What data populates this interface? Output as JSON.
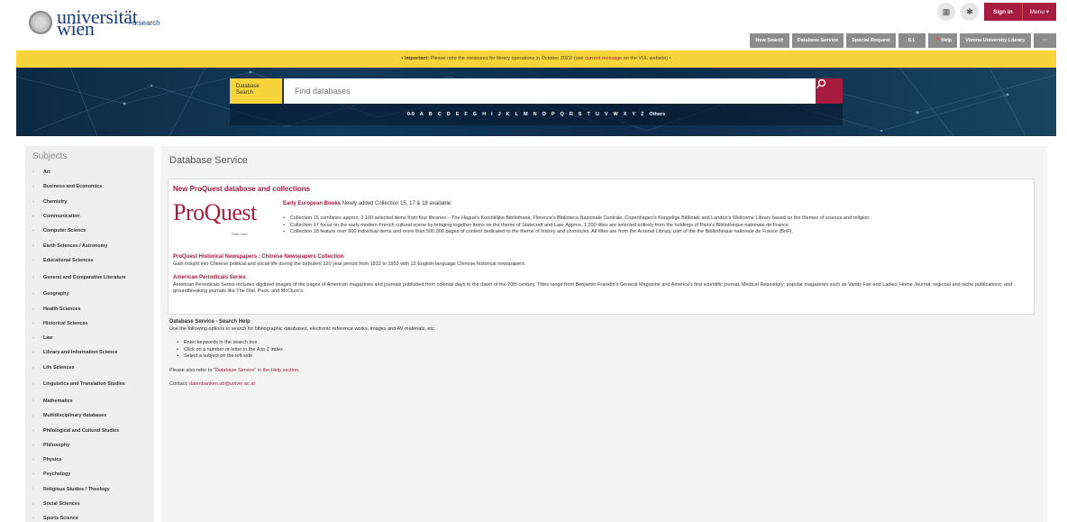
{
  "header": {
    "logo_line1": "universität",
    "logo_line2": "wien",
    "breadcrumb": "› u:search",
    "signin_label": "Sign in",
    "menu_label": "Menu ▾"
  },
  "nav": {
    "items": [
      "New Search",
      "Database Service",
      "Special Request",
      "ILL",
      "❓ Help",
      "Vienna University Library",
      "···"
    ]
  },
  "notice": {
    "prefix": "• ",
    "important": "Important:",
    "text": " Please note the measures for library operations in October 2021! (see ",
    "link": "current message",
    "suffix": " on the VUL website) •"
  },
  "search": {
    "label_line1": "Database",
    "label_line2": "Search",
    "placeholder": "Find databases",
    "az": [
      "0-9",
      "A",
      "B",
      "C",
      "D",
      "E",
      "F",
      "G",
      "H",
      "I",
      "J",
      "K",
      "L",
      "M",
      "N",
      "O",
      "P",
      "Q",
      "R",
      "S",
      "T",
      "U",
      "V",
      "W",
      "X",
      "Y",
      "Z",
      "Others"
    ]
  },
  "sidebar": {
    "title": "Subjects",
    "items": [
      "Art",
      "Business and Economics",
      "Chemistry",
      "Communication",
      "Computer Science",
      "Earth Sciences / Astronomy",
      "Educational Sciences",
      "General and Comparative Literature",
      "Geography",
      "Health Sciences",
      "Historical Sciences",
      "Law",
      "Library and Information Science",
      "Life Sciences",
      "Linguistics and Translation Studies",
      "Mathematics",
      "Multidisciplinary databases",
      "Philological and Cultural Studies",
      "Philosophy",
      "Physics",
      "Psychology",
      "Religious Studies / Theology",
      "Social Sciences",
      "Sports Science"
    ]
  },
  "main": {
    "title": "Database Service",
    "news": {
      "heading": "New ProQuest database and collections",
      "logo_text": "ProQuest",
      "logo_tagline": "Start here.",
      "eeb_title": "Early European Books",
      "eeb_intro": " Newly added Collection 15, 17 & 18 available:",
      "eeb_items": [
        "Collection 15 combines approx. 3.100 selected items from four libraries – The Hague's Koninklijke Bibliotheek, Florence's Biblioteca Nazionale Centrale, Copenhagen's Kongelige Bibliotek and London's Wellcome Library based on the themes of science and religion.",
        "Collection 17 focus on the early modern French cultural scene by bringing together items on the theme of Statecraft and Law. Approx. 1.200 titles are selected entirely from the holdings of Paris's Bibliothèque nationale de France.",
        "Collection 18 feature over 900 individual items and more than 500,000 pages of content dedicated to the theme of history and chronicles. All titles are from the Arsenal Library, part of the the Bibliothèque nationale de France (BnF)."
      ],
      "hist_title": "ProQuest Historical Newspapers : Chinese Newspapers Collection",
      "hist_text": "Gain insight into Chinese political and social life during the turbulent 120 year period from 1832 to 1953 with 12 English-language Chinese historical newspapers.",
      "amp_title": "American Periodicals Series",
      "amp_text": "American Periodicals Series includes digitized images of the pages of American magazines and journals published from colonial days to the dawn of the 20th century. Titles range from Benjamin Franklin's General Magazine and America's first scientific journal, Medical Repository; popular magazines such as Vanity Fair and Ladies' Home Journal; regional and niche publications; and groundbreaking journals like The Dial, Puck, and McClure's."
    },
    "help": {
      "title": "Database Service - Search Help",
      "intro": "Use the following options to search for bibliographic databases, electronic reference works, images and AV materials, etc:",
      "items": [
        "Enter keywords in the search box",
        "Click on a number or letter in the A to Z index",
        "Select a subject on the left side"
      ],
      "refer_prefix": "Please also refer to ",
      "refer_link": "\"Database Service\" in the Help section.",
      "contact_prefix": "Contact: ",
      "contact_email": "datenbanken.ub@univie.ac.at"
    }
  }
}
